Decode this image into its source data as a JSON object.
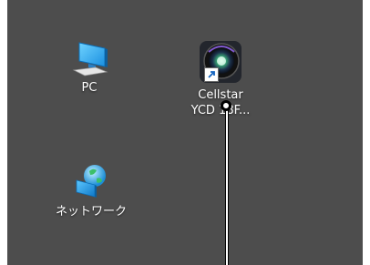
{
  "desktop": {
    "background_color": "#4d4d4d",
    "icons": [
      {
        "label": "PC",
        "icon": "monitor-icon",
        "interactable": true
      },
      {
        "label": "Cellstar\nYCD 18F...",
        "line1": "Cellstar",
        "line2": "YCD 18F...",
        "icon": "camera-lens-shortcut-icon",
        "interactable": true
      },
      {
        "label": "ネットワーク",
        "icon": "network-globe-icon",
        "interactable": true
      }
    ]
  },
  "pointer": {
    "type": "touch-pointer-line"
  }
}
